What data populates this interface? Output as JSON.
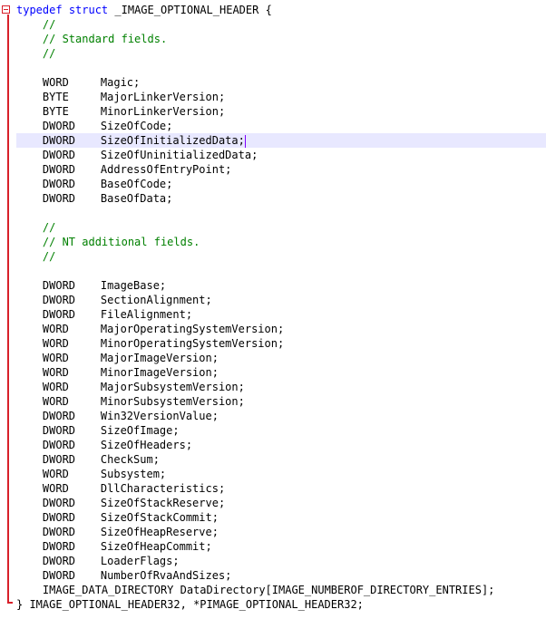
{
  "editor": {
    "header": {
      "keyword_typedef": "typedef",
      "keyword_struct": "struct",
      "name": "_IMAGE_OPTIONAL_HEADER {"
    },
    "comment_std": [
      "//",
      "// Standard fields.",
      "//"
    ],
    "standard_fields": [
      {
        "type": "WORD",
        "name": "Magic;"
      },
      {
        "type": "BYTE",
        "name": "MajorLinkerVersion;"
      },
      {
        "type": "BYTE",
        "name": "MinorLinkerVersion;"
      },
      {
        "type": "DWORD",
        "name": "SizeOfCode;"
      },
      {
        "type": "DWORD",
        "name": "SizeOfInitializedData;"
      },
      {
        "type": "DWORD",
        "name": "SizeOfUninitializedData;"
      },
      {
        "type": "DWORD",
        "name": "AddressOfEntryPoint;"
      },
      {
        "type": "DWORD",
        "name": "BaseOfCode;"
      },
      {
        "type": "DWORD",
        "name": "BaseOfData;"
      }
    ],
    "comment_nt": [
      "//",
      "// NT additional fields.",
      "//"
    ],
    "nt_fields": [
      {
        "type": "DWORD",
        "name": "ImageBase;"
      },
      {
        "type": "DWORD",
        "name": "SectionAlignment;"
      },
      {
        "type": "DWORD",
        "name": "FileAlignment;"
      },
      {
        "type": "WORD",
        "name": "MajorOperatingSystemVersion;"
      },
      {
        "type": "WORD",
        "name": "MinorOperatingSystemVersion;"
      },
      {
        "type": "WORD",
        "name": "MajorImageVersion;"
      },
      {
        "type": "WORD",
        "name": "MinorImageVersion;"
      },
      {
        "type": "WORD",
        "name": "MajorSubsystemVersion;"
      },
      {
        "type": "WORD",
        "name": "MinorSubsystemVersion;"
      },
      {
        "type": "DWORD",
        "name": "Win32VersionValue;"
      },
      {
        "type": "DWORD",
        "name": "SizeOfImage;"
      },
      {
        "type": "DWORD",
        "name": "SizeOfHeaders;"
      },
      {
        "type": "DWORD",
        "name": "CheckSum;"
      },
      {
        "type": "WORD",
        "name": "Subsystem;"
      },
      {
        "type": "WORD",
        "name": "DllCharacteristics;"
      },
      {
        "type": "DWORD",
        "name": "SizeOfStackReserve;"
      },
      {
        "type": "DWORD",
        "name": "SizeOfStackCommit;"
      },
      {
        "type": "DWORD",
        "name": "SizeOfHeapReserve;"
      },
      {
        "type": "DWORD",
        "name": "SizeOfHeapCommit;"
      },
      {
        "type": "DWORD",
        "name": "LoaderFlags;"
      },
      {
        "type": "DWORD",
        "name": "NumberOfRvaAndSizes;"
      }
    ],
    "data_directory_line": "IMAGE_DATA_DIRECTORY DataDirectory[IMAGE_NUMBEROF_DIRECTORY_ENTRIES];",
    "footer": "} IMAGE_OPTIONAL_HEADER32, *PIMAGE_OPTIONAL_HEADER32;",
    "colors": {
      "keyword": "#0000ff",
      "comment": "#008000",
      "fold_marker": "#d8202a",
      "current_line": "#e8e8ff",
      "caret": "#8000ff"
    }
  }
}
